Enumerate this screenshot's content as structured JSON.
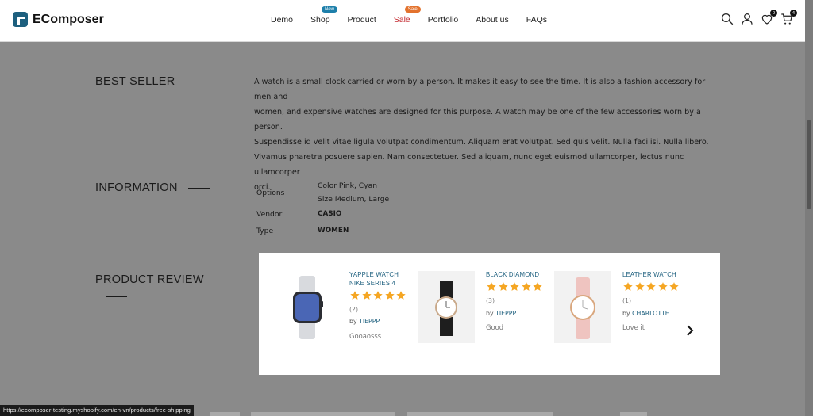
{
  "brand": {
    "name": "EComposer"
  },
  "nav": {
    "items": [
      {
        "label": "Demo"
      },
      {
        "label": "Shop",
        "badge": "New"
      },
      {
        "label": "Product"
      },
      {
        "label": "Sale",
        "badge": "Sale"
      },
      {
        "label": "Portfolio"
      },
      {
        "label": "About us"
      },
      {
        "label": "FAQs"
      }
    ]
  },
  "header_icons": {
    "search": "search-icon",
    "account": "user-icon",
    "wishlist": "heart-icon",
    "wishlist_count": "0",
    "cart": "cart-icon",
    "cart_count": "4"
  },
  "best_seller": {
    "title": "BEST SELLER",
    "lines": [
      "A watch is a small clock carried or worn by a person. It makes it easy to see the time. It is also a fashion accessory for men and",
      "women, and expensive watches are designed for this purpose. A watch may be one of the few accessories worn by a person.",
      "Suspendisse id velit vitae ligula volutpat condimentum. Aliquam erat volutpat. Sed quis velit. Nulla facilisi. Nulla libero.",
      "Vivamus pharetra posuere sapien. Nam consectetuer. Sed aliquam, nunc eget euismod ullamcorper, lectus nunc ullamcorper",
      "orci."
    ]
  },
  "information": {
    "title": "INFORMATION",
    "options_label": "Options",
    "options": [
      "Color Pink, Cyan",
      "Size Medium, Large"
    ],
    "vendor_label": "Vendor",
    "vendor": "CASIO",
    "type_label": "Type",
    "type": "WOMEN"
  },
  "product_review": {
    "title": "PRODUCT REVIEW",
    "rating_color": "#f5a623",
    "cards": [
      {
        "title_line1": "YAPPLE WATCH",
        "title_line2": "NIKE SERIES 4",
        "rating": 5,
        "count": "(2)",
        "by": "by",
        "author": "TIEPPP",
        "comment": "Gooaosss"
      },
      {
        "title_line1": "BLACK DIAMOND",
        "title_line2": "",
        "rating": 5,
        "count": "(3)",
        "by": "by",
        "author": "TIEPPP",
        "comment": "Good"
      },
      {
        "title_line1": "LEATHER WATCH",
        "title_line2": "",
        "rating": 5,
        "count": "(1)",
        "by": "by",
        "author": "CHARLOTTE",
        "comment": "Love it"
      }
    ]
  },
  "status_url": "https://ecomposer-testing.myshopify.com/en-vn/products/free-shipping"
}
